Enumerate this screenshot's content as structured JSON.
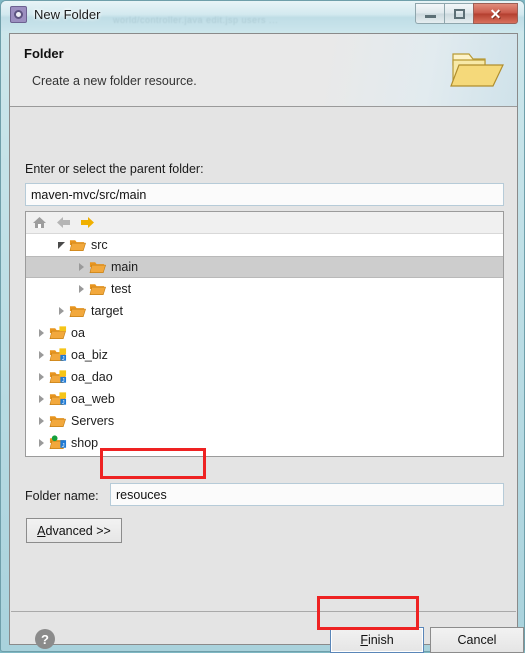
{
  "window": {
    "title": "New Folder",
    "app_icon": "eclipse-wizard-icon",
    "ghost_text": "world/controller.java      edit.jsp        users ...",
    "buttons": {
      "minimize": "minimize-icon",
      "maximize": "restore-icon",
      "close": "✕"
    }
  },
  "banner": {
    "title": "Folder",
    "subtitle": "Create a new folder resource.",
    "icon": "open-folder-banner-icon"
  },
  "parent": {
    "label": "Enter or select the parent folder:",
    "value": "maven-mvc/src/main",
    "placeholder": ""
  },
  "tree": {
    "toolbar": [
      {
        "name": "home-icon",
        "title": "Home"
      },
      {
        "name": "back-arrow-icon",
        "title": "Back"
      },
      {
        "name": "forward-arrow-icon",
        "title": "Forward"
      }
    ],
    "rows": [
      {
        "label": "src",
        "indent": 1,
        "state": "expanded",
        "icon": "folder-icon",
        "selected": false
      },
      {
        "label": "main",
        "indent": 2,
        "state": "collapsed",
        "icon": "folder-icon",
        "selected": true
      },
      {
        "label": "test",
        "indent": 2,
        "state": "collapsed",
        "icon": "folder-icon",
        "selected": false
      },
      {
        "label": "target",
        "indent": 1,
        "state": "collapsed",
        "icon": "folder-icon",
        "selected": false
      },
      {
        "label": "oa",
        "indent": 0,
        "state": "collapsed",
        "icon": "project-folder-icon",
        "selected": false
      },
      {
        "label": "oa_biz",
        "indent": 0,
        "state": "collapsed",
        "icon": "java-project-icon",
        "selected": false
      },
      {
        "label": "oa_dao",
        "indent": 0,
        "state": "collapsed",
        "icon": "java-project-icon",
        "selected": false
      },
      {
        "label": "oa_web",
        "indent": 0,
        "state": "collapsed",
        "icon": "java-project-icon",
        "selected": false
      },
      {
        "label": "Servers",
        "indent": 0,
        "state": "collapsed",
        "icon": "folder-icon",
        "selected": false
      },
      {
        "label": "shop",
        "indent": 0,
        "state": "collapsed",
        "icon": "web-project-icon",
        "selected": false
      }
    ]
  },
  "folder_name": {
    "label": "Folder name:",
    "value": "resouces",
    "placeholder": ""
  },
  "advanced": {
    "prefix": "A",
    "rest": "dvanced >>"
  },
  "footer": {
    "help_icon": "help-icon",
    "finish": {
      "prefix": "F",
      "rest": "inish"
    },
    "cancel": "Cancel"
  },
  "colors": {
    "annotation": "#ee2222",
    "selection": "#cdcdcd",
    "dialog_bg": "#e4e4e4",
    "folder_orange": "#e8951f",
    "close_red": "#c9594a"
  }
}
